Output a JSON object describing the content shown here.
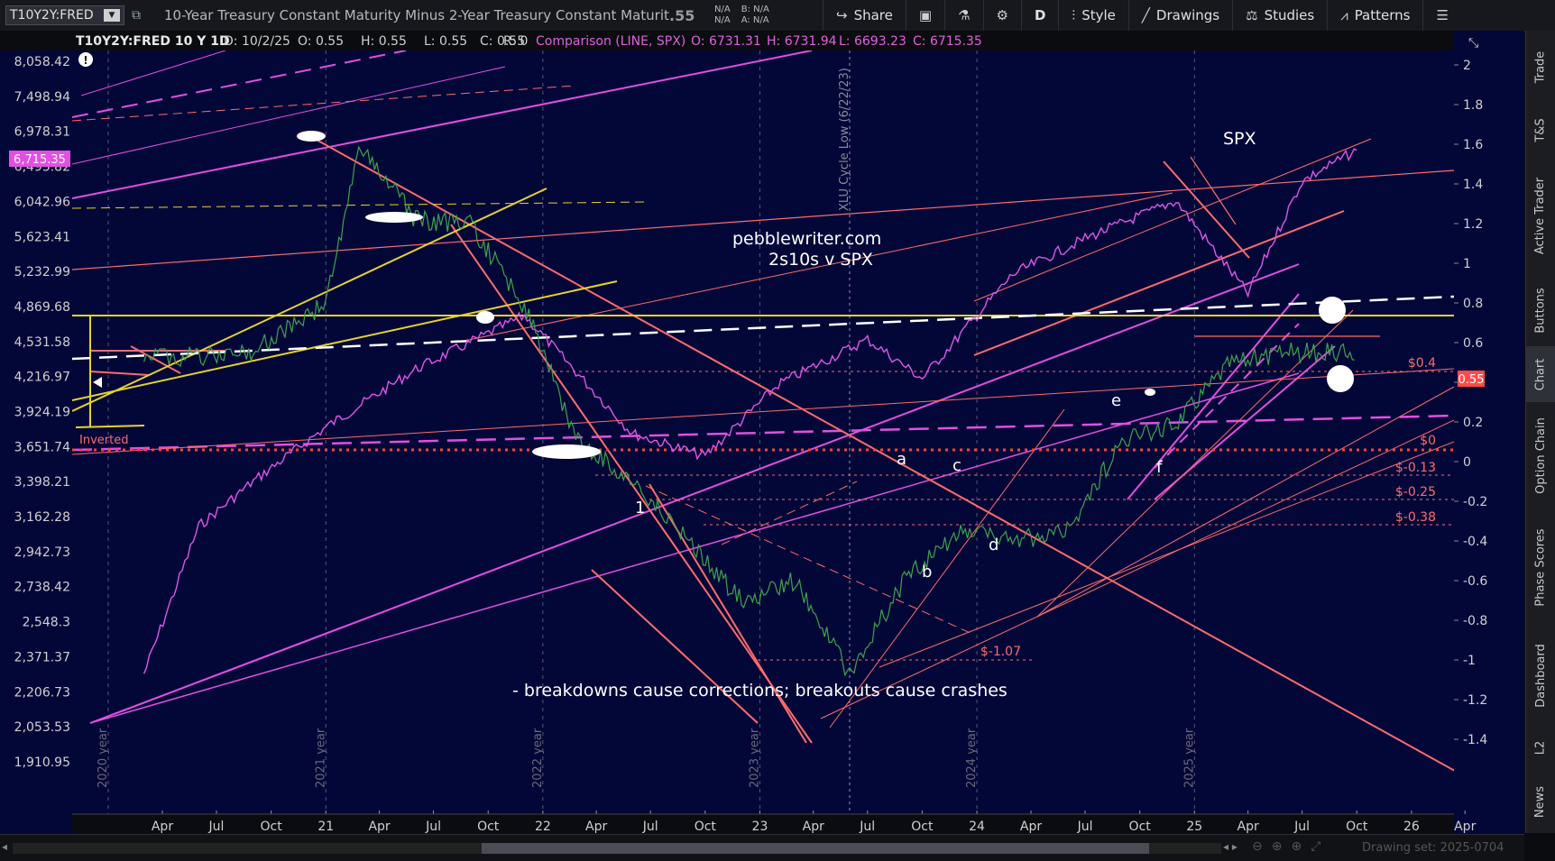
{
  "toolbar": {
    "symbol": "T10Y2Y:FRED",
    "description": "10-Year Treasury Constant Maturity Minus 2-Year Treasury Constant Maturity",
    "last": ".55",
    "bid_label": "N/A",
    "bid_value": "N/A",
    "ask_label": "B: N/A",
    "ask_value": "A: N/A",
    "share": "Share",
    "period": "D",
    "style": "Style",
    "drawings": "Drawings",
    "studies": "Studies",
    "patterns": "Patterns"
  },
  "sidetabs": [
    "Trade",
    "T&S",
    "Active Trader",
    "Buttons",
    "Chart",
    "Option Chain",
    "Phase Scores",
    "Dashboard",
    "L2",
    "News"
  ],
  "header": {
    "title": "T10Y2Y:FRED 10 Y 1D",
    "d": "D: 10/2/25",
    "o": "O: 0.55",
    "h": "H: 0.55",
    "l": "L: 0.55",
    "c": "C: 0.55",
    "r": "R: 0",
    "comparison": "Comparison (LINE, SPX)",
    "co": "O: 6731.31",
    "ch": "H: 6731.94",
    "cl": "L: 6693.23",
    "cc": "C: 6715.35"
  },
  "footer": {
    "drawing_set": "Drawing set: 2025-0704"
  },
  "colors": {
    "background": "#030738",
    "spx": "#e055e8",
    "candles": "#3fa34d",
    "trend_red": "#ff6b6b",
    "yellow": "#e8d22e",
    "magenta": "#e34fe0"
  },
  "chart_data": {
    "type": "line",
    "title": "",
    "left_axis_ticks": [
      "8,058.42",
      "7,498.94",
      "6,978.31",
      "6,493.82",
      "6,042.96",
      "5,623.41",
      "5,232.99",
      "4,869.68",
      "4,531.58",
      "4,216.97",
      "3,924.19",
      "3,651.74",
      "3,398.21",
      "3,162.28",
      "2,942.73",
      "2,738.42",
      "2,548.3",
      "2,371.37",
      "2,206.73",
      "2,053.53",
      "1,910.95"
    ],
    "left_axis_scale": "log",
    "right_axis_ticks": [
      "2",
      "1.8",
      "1.6",
      "1.4",
      "1.2",
      "1",
      "0.8",
      "0.6",
      "0.4",
      "0.2",
      "0",
      "-0.2",
      "-0.4",
      "-0.6",
      "-0.8",
      "-1",
      "-1.2",
      "-1.4"
    ],
    "ylim_right": [
      -1.4,
      2.0
    ],
    "ylim_left": [
      1910.95,
      8058.42
    ],
    "x_ticks": [
      "Apr",
      "Jul",
      "Oct",
      "21",
      "Apr",
      "Jul",
      "Oct",
      "22",
      "Apr",
      "Jul",
      "Oct",
      "23",
      "Apr",
      "Jul",
      "Oct",
      "24",
      "Apr",
      "Jul",
      "Oct",
      "25",
      "Apr",
      "Jul",
      "Oct",
      "26",
      "Apr"
    ],
    "year_markers": [
      "2020 year",
      "2021 year",
      "2022 year",
      "2023 year",
      "2024 year",
      "2025 year"
    ],
    "event_marker": "XLU Cycle Low (6/22/23)",
    "series": [
      {
        "name": "T10Y2Y",
        "x": [
          "2020-03",
          "2020-06",
          "2020-09",
          "2021-01",
          "2021-03",
          "2021-06",
          "2021-09",
          "2021-12",
          "2022-03",
          "2022-06",
          "2022-09",
          "2022-12",
          "2023-03",
          "2023-06",
          "2023-09",
          "2023-12",
          "2024-03",
          "2024-06",
          "2024-09",
          "2024-12",
          "2025-03",
          "2025-06",
          "2025-10"
        ],
        "values": [
          0.55,
          0.52,
          0.56,
          0.8,
          1.6,
          1.22,
          1.2,
          0.78,
          0.1,
          -0.1,
          -0.4,
          -0.7,
          -0.6,
          -1.07,
          -0.6,
          -0.35,
          -0.4,
          -0.35,
          0.1,
          0.2,
          0.5,
          0.55,
          0.55
        ]
      },
      {
        "name": "SPX",
        "x": [
          "2020-03",
          "2020-06",
          "2020-09",
          "2021-01",
          "2021-06",
          "2021-12",
          "2022-06",
          "2022-10",
          "2023-02",
          "2023-07",
          "2023-10",
          "2024-03",
          "2024-07",
          "2024-12",
          "2025-04",
          "2025-07",
          "2025-10"
        ],
        "values": [
          2290,
          3100,
          3400,
          3800,
          4280,
          4780,
          3750,
          3580,
          4150,
          4550,
          4200,
          5200,
          5600,
          6050,
          5000,
          6300,
          6715
        ]
      }
    ],
    "price_marker": "6,715.35",
    "last_marker": "0.55",
    "levels": [
      {
        "label": "$0.4",
        "value": 0.4
      },
      {
        "label": "$0",
        "value": 0
      },
      {
        "label": "$-0.13",
        "value": -0.13
      },
      {
        "label": "$-0.25",
        "value": -0.25
      },
      {
        "label": "$-0.38",
        "value": -0.38
      },
      {
        "label": "$-1.07",
        "value": -1.07
      }
    ],
    "annotations": {
      "site": "pebblewriter.com",
      "subtitle": "2s10s  v  SPX",
      "spx": "SPX",
      "inverted": "Inverted",
      "caption": "- breakdowns cause corrections; breakouts cause crashes",
      "waves": [
        "1",
        "a",
        "b",
        "c",
        "d",
        "e",
        "f"
      ]
    }
  }
}
